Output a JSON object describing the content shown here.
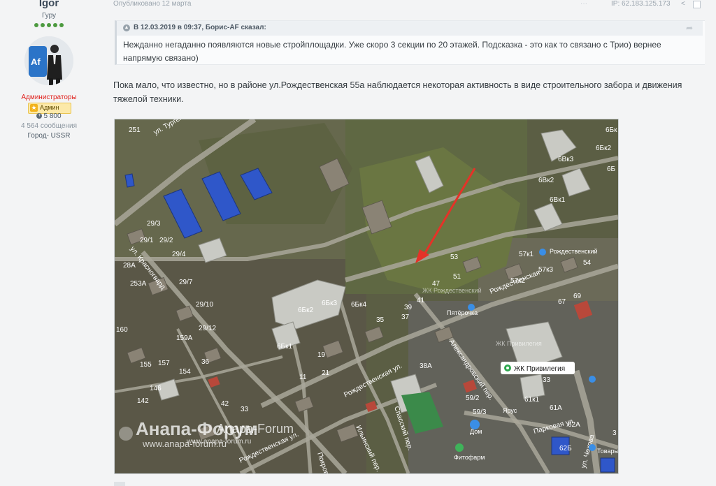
{
  "author": {
    "name": "Igor",
    "rank": "Гуру",
    "group": "Администраторы",
    "badge": "Админ",
    "reputation": "5 800",
    "posts": "4 564 сообщения",
    "city": "Город- USSR",
    "avatar_text": "Af"
  },
  "post": {
    "published": "Опубликовано 12 марта",
    "ip": "IP: 62.183.125.173",
    "quote": {
      "cite": "В 12.03.2019 в 09:37, Борис-AF сказал:",
      "text": "Нежданно негаданно появляются новые стройплощадки. Уже скоро 3 секции по 20 этажей. Подсказка - это как то связано с Трио) вернее напрямую связано)"
    },
    "text": "Пока мало, что известно, но в районе ул.Рождественская 55а наблюдается некоторая активность в виде строительного забора и движения тяжелой техники."
  },
  "map": {
    "streets": {
      "turgeneva": "ул. Тургене",
      "krasnogvard": "ул. Красногвард",
      "rozhd_right": "Рождественская",
      "rozhd_mid": "Рождественская ул.",
      "rozhd_bottom": "Рождественская ул.",
      "aleksandr": "Александровский пер.",
      "spassky": "Спасский пер.",
      "ilinsky": "Ильинский пер.",
      "parkovaya": "Парковая ул.",
      "chekhova": "ул. Чехова",
      "pokrov": "Покров"
    },
    "pois": {
      "zhk_rozhd": "Рождественский",
      "zhk_rozhd_ghost": "ЖК Рождественский",
      "zhk_priv": "ЖК Привилегия",
      "zhk_priv_ghost": "ЖК Привилегия",
      "pyaterochka": "Пятёрочка",
      "dom": "Дом",
      "fitofarm": "Фитофарм",
      "tovary": "Товары",
      "yarus": "Ярус"
    },
    "labels": [
      "251",
      "29/3",
      "29/1",
      "29/2",
      "29/4",
      "28А",
      "253А",
      "29/7",
      "29/10",
      "29/12",
      "160",
      "159А",
      "155",
      "157",
      "154",
      "146",
      "142",
      "36",
      "42",
      "33",
      "11",
      "19",
      "21",
      "35",
      "37",
      "39",
      "41",
      "47",
      "51",
      "53",
      "57к1",
      "57к3",
      "57к2",
      "54",
      "69",
      "67",
      "6Бк1",
      "6Бк2",
      "6Бк3",
      "6Бк4",
      "6Вк1",
      "6Вк2",
      "6Вк3",
      "6Бк2",
      "6Бк",
      "6Б",
      "38А",
      "59/2",
      "59/3",
      "61к1",
      "61А",
      "62А",
      "62Б",
      "33",
      "3"
    ],
    "watermark_main": "Анапа-Форум",
    "watermark_small": "Anapa-Forum",
    "watermark_url1": "www.anapa-forum.ru",
    "watermark_url2": "www.anapa-forum.ru"
  }
}
